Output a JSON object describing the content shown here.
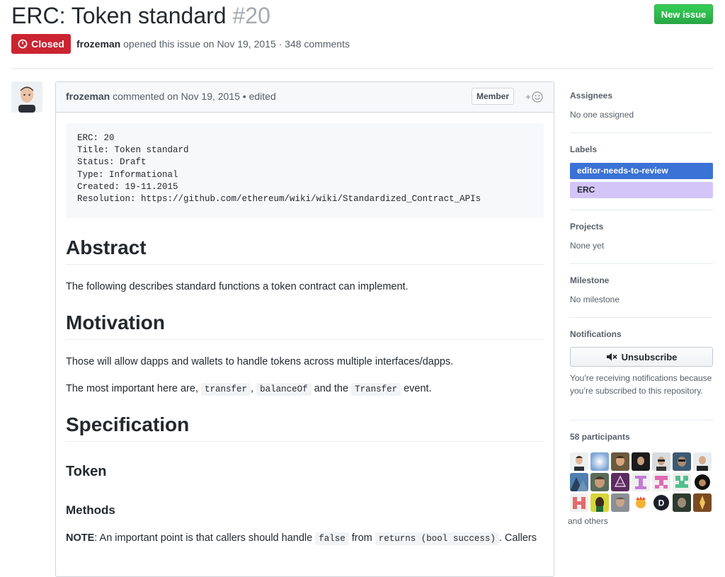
{
  "issue": {
    "title": "ERC: Token standard",
    "number": "#20",
    "state": "Closed",
    "author": "frozeman",
    "opened_text": "opened this issue on Nov 19, 2015 · 348 comments",
    "new_issue_label": "New issue"
  },
  "comment": {
    "author": "frozeman",
    "meta": "commented on Nov 19, 2015 • edited",
    "role_label": "Member",
    "reaction_icon": "smiley-add-icon",
    "pre_lines": [
      "ERC: 20",
      "Title: Token standard",
      "Status: Draft",
      "Type: Informational",
      "Created: 19-11.2015",
      "Resolution: https://github.com/ethereum/wiki/wiki/Standardized_Contract_APIs"
    ],
    "abstract_heading": "Abstract",
    "abstract_text": "The following describes standard functions a token contract can implement.",
    "motivation_heading": "Motivation",
    "motivation_text": "Those will allow dapps and wallets to handle tokens across multiple interfaces/dapps.",
    "important": {
      "prefix": "The most important here are,",
      "code1": "transfer",
      "sep": ",",
      "code2": "balanceOf",
      "mid": "and the",
      "code3": "Transfer",
      "suffix": "event."
    },
    "specification_heading": "Specification",
    "token_heading": "Token",
    "methods_heading": "Methods",
    "note": {
      "bold": "NOTE",
      "text1": ": An important point is that callers should handle",
      "code1": "false",
      "text2": "from",
      "code2": "returns (bool success)",
      "text3": ". Callers"
    }
  },
  "sidebar": {
    "assignees_heading": "Assignees",
    "assignees_value": "No one assigned",
    "labels_heading": "Labels",
    "labels": [
      {
        "name": "editor-needs-to-review",
        "bg": "#3b72d6",
        "fg": "#ffffff"
      },
      {
        "name": "ERC",
        "bg": "#d4c5f9",
        "fg": "#24292e"
      }
    ],
    "projects_heading": "Projects",
    "projects_value": "None yet",
    "milestone_heading": "Milestone",
    "milestone_value": "No milestone",
    "notifications_heading": "Notifications",
    "unsubscribe_label": "Unsubscribe",
    "notif_reason": "You’re receiving notifications because you’re subscribed to this repository.",
    "participants_heading": "58 participants",
    "and_others": "and others"
  },
  "colors": {
    "closed": "#cb2431",
    "new_issue": "#28a745"
  }
}
